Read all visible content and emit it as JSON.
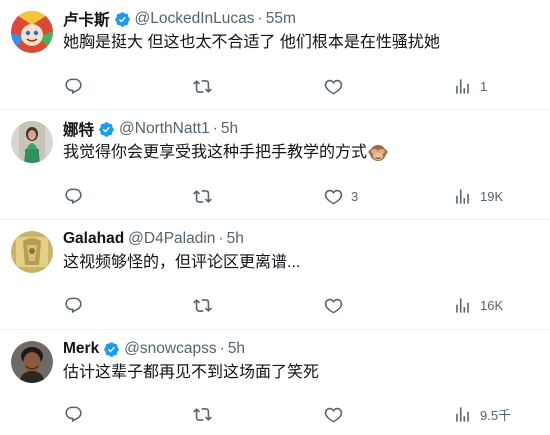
{
  "colors": {
    "accent": "#1d9bf0",
    "text": "#0f1419",
    "muted": "#536471",
    "divider": "#eff3f4"
  },
  "icons": {
    "reply": "reply-icon",
    "retweet": "retweet-icon",
    "like": "heart-icon",
    "views": "views-chart-icon",
    "verified": "verified-badge-icon",
    "emoji": "see-no-evil-monkey-emoji"
  },
  "tweets": [
    {
      "name": "卢卡斯",
      "handle": "@LockedInLucas",
      "dot": "·",
      "time": "55m",
      "text": "她胸是挺大 但这也太不合适了 他们根本是在性骚扰她",
      "reply": "",
      "retweet": "",
      "like": "",
      "views": "1"
    },
    {
      "name": "娜特",
      "handle": "@NorthNatt1",
      "dot": "·",
      "time": "5h",
      "text": "我觉得你会更享受我这种手把手教学的方式",
      "reply": "",
      "retweet": "",
      "like": "3",
      "views": "19K"
    },
    {
      "name": "Galahad",
      "handle": "@D4Paladin",
      "dot": "·",
      "time": "5h",
      "text": "这视频够怪的，但评论区更离谱...",
      "reply": "",
      "retweet": "",
      "like": "",
      "views": "16K"
    },
    {
      "name": "Merk",
      "handle": "@snowcapss",
      "dot": "·",
      "time": "5h",
      "text": "估计这辈子都再见不到这场面了笑死",
      "reply": "",
      "retweet": "",
      "like": "",
      "views": "9.5千"
    }
  ]
}
